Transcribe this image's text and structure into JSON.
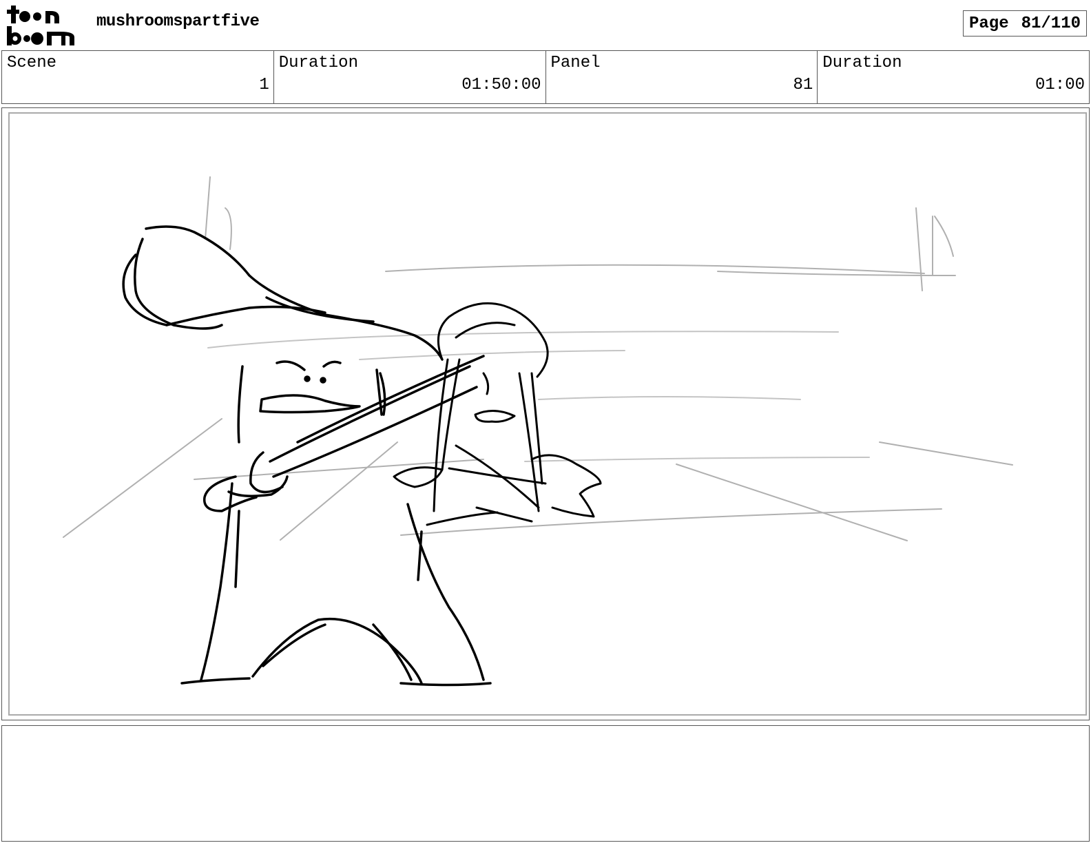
{
  "header": {
    "logo_text": "toon boom",
    "project_name": "mushroomspartfive",
    "page_label": "Page",
    "page_value": "81/110"
  },
  "info": {
    "scene_label": "Scene",
    "scene_value": "1",
    "scene_duration_label": "Duration",
    "scene_duration_value": "01:50:00",
    "panel_label": "Panel",
    "panel_value": "81",
    "panel_duration_label": "Duration",
    "panel_duration_value": "01:00"
  },
  "panel": {
    "image": "storyboard-sketch-two-mushroom-characters"
  },
  "notes": {
    "text": ""
  }
}
